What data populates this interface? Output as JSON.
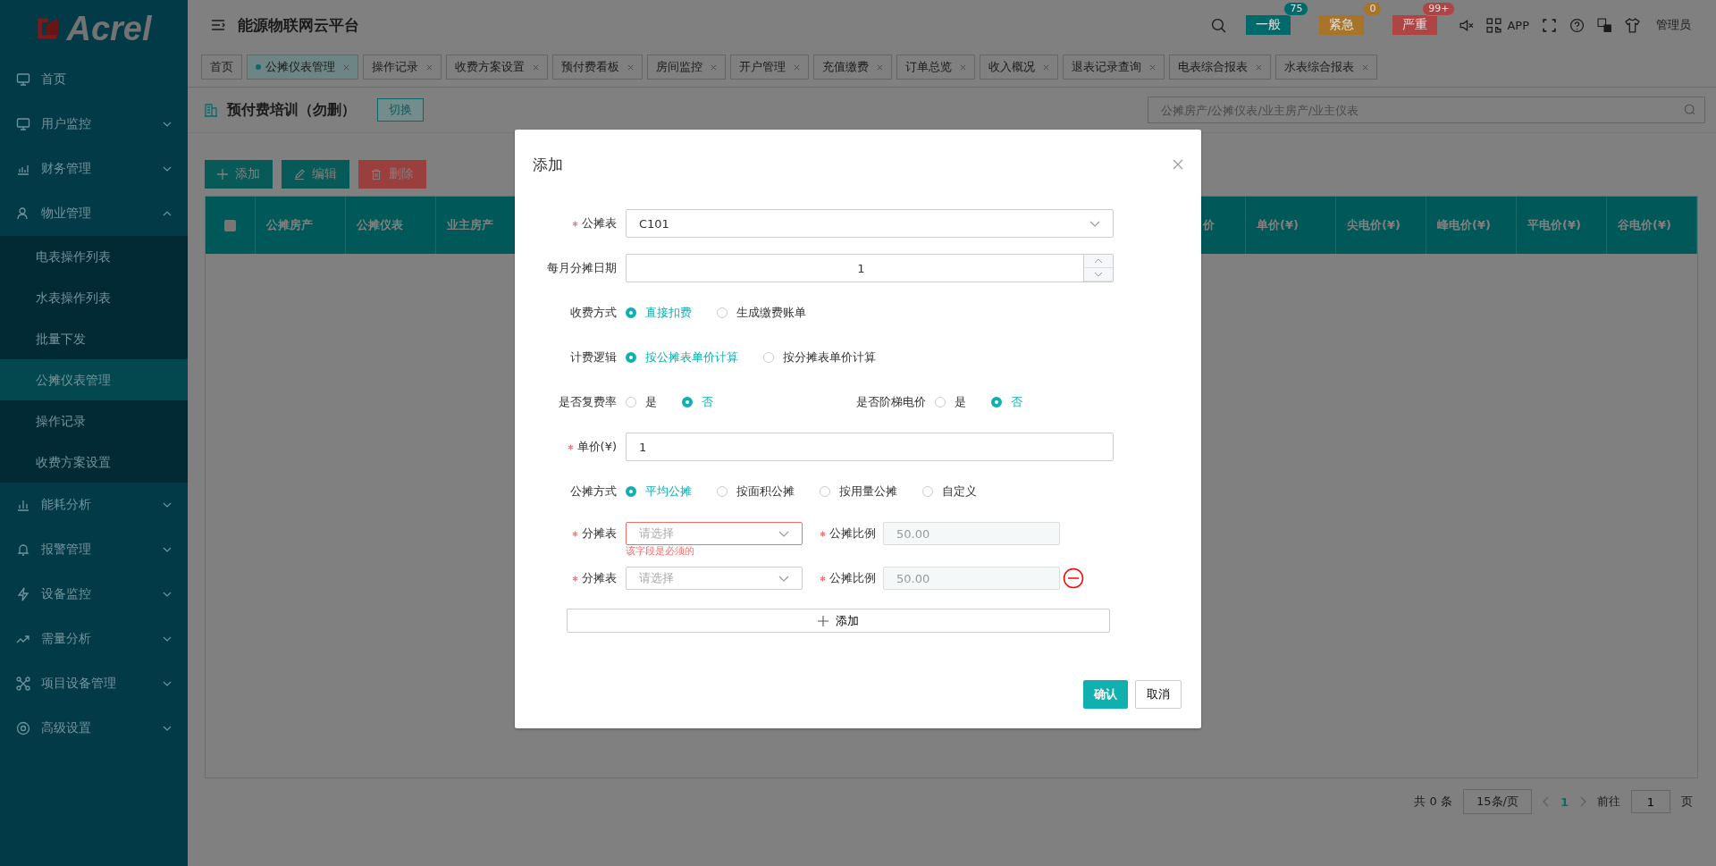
{
  "logo": "Acrel",
  "header": {
    "title": "能源物联网云平台",
    "app_label": "APP",
    "user": "管理员",
    "alarms": [
      {
        "label": "一般",
        "count": "75",
        "color": "#006a6a"
      },
      {
        "label": "紧急",
        "count": "0",
        "color": "#a8742a"
      },
      {
        "label": "严重",
        "count": "99+",
        "color": "#ae4444"
      }
    ]
  },
  "tabs": [
    {
      "label": "首页",
      "selected": false,
      "closable": false
    },
    {
      "label": "公摊仪表管理",
      "selected": true,
      "closable": true
    },
    {
      "label": "操作记录",
      "selected": false,
      "closable": true
    },
    {
      "label": "收费方案设置",
      "selected": false,
      "closable": true
    },
    {
      "label": "预付费看板",
      "selected": false,
      "closable": true
    },
    {
      "label": "房间监控",
      "selected": false,
      "closable": true
    },
    {
      "label": "开户管理",
      "selected": false,
      "closable": true
    },
    {
      "label": "充值缴费",
      "selected": false,
      "closable": true
    },
    {
      "label": "订单总览",
      "selected": false,
      "closable": true
    },
    {
      "label": "收入概况",
      "selected": false,
      "closable": true
    },
    {
      "label": "退表记录查询",
      "selected": false,
      "closable": true
    },
    {
      "label": "电表综合报表",
      "selected": false,
      "closable": true
    },
    {
      "label": "水表综合报表",
      "selected": false,
      "closable": true
    }
  ],
  "sidebar": {
    "items": [
      {
        "label": "首页",
        "selected": false
      },
      {
        "label": "用户监控",
        "selected": false,
        "expanded": false
      },
      {
        "label": "财务管理",
        "selected": false,
        "expanded": false
      },
      {
        "label": "物业管理",
        "selected": false,
        "expanded": true,
        "children": [
          {
            "label": "电表操作列表",
            "selected": false
          },
          {
            "label": "水表操作列表",
            "selected": false
          },
          {
            "label": "批量下发",
            "selected": false
          },
          {
            "label": "公摊仪表管理",
            "selected": true
          },
          {
            "label": "操作记录",
            "selected": false
          },
          {
            "label": "收费方案设置",
            "selected": false
          }
        ]
      },
      {
        "label": "能耗分析",
        "selected": false,
        "expanded": false
      },
      {
        "label": "报警管理",
        "selected": false,
        "expanded": false
      },
      {
        "label": "设备监控",
        "selected": false,
        "expanded": false
      },
      {
        "label": "需量分析",
        "selected": false,
        "expanded": false
      },
      {
        "label": "项目设备管理",
        "selected": false,
        "expanded": false
      },
      {
        "label": "高级设置",
        "selected": false,
        "expanded": false
      }
    ]
  },
  "page": {
    "title": "预付费培训（勿删）",
    "switch_button": "切换",
    "search": {
      "placeholder": "公摊房产/公摊仪表/业主房产/业主仪表"
    },
    "toolbar": [
      {
        "label": "添加",
        "kind": "add"
      },
      {
        "label": "编辑",
        "kind": "edit"
      },
      {
        "label": "删除",
        "kind": "delete"
      }
    ],
    "table": {
      "select_all_checked": false,
      "columns_left": [
        "公摊房产",
        "公摊仪表",
        "业主房产"
      ],
      "column_partial": "价",
      "columns_right": [
        "单价(¥)",
        "尖电价(¥)",
        "峰电价(¥)",
        "平电价(¥)",
        "谷电价(¥)"
      ]
    },
    "pagination": {
      "total": "共 0 条",
      "page_size": "15条/页",
      "current_page": "1",
      "goto_label": "前往",
      "goto_value": "1",
      "page_suffix": "页"
    }
  },
  "dialog": {
    "title": "添加",
    "rows": [
      {
        "kind": "select",
        "label": "公摊表",
        "required": true,
        "value": "C101"
      },
      {
        "kind": "number",
        "label": "每月分摊日期",
        "required": false,
        "value": "1"
      },
      {
        "kind": "radio",
        "groups": [
          {
            "label": "收费方式",
            "options": [
              {
                "label": "直接扣费",
                "selected": true
              },
              {
                "label": "生成缴费账单",
                "selected": false
              }
            ]
          }
        ]
      },
      {
        "kind": "radio",
        "groups": [
          {
            "label": "计费逻辑",
            "options": [
              {
                "label": "按公摊表单价计算",
                "selected": true
              },
              {
                "label": "按分摊表单价计算",
                "selected": false
              }
            ]
          }
        ]
      },
      {
        "kind": "radio",
        "groups": [
          {
            "label": "是否复费率",
            "options": [
              {
                "label": "是",
                "selected": false
              },
              {
                "label": "否",
                "selected": true
              }
            ]
          },
          {
            "label": "是否阶梯电价",
            "options": [
              {
                "label": "是",
                "selected": false
              },
              {
                "label": "否",
                "selected": true
              }
            ]
          }
        ]
      },
      {
        "kind": "text",
        "label": "单价(¥)",
        "required": true,
        "value": "1"
      },
      {
        "kind": "radio",
        "groups": [
          {
            "label": "公摊方式",
            "options": [
              {
                "label": "平均公摊",
                "selected": true
              },
              {
                "label": "按面积公摊",
                "selected": false
              },
              {
                "label": "按用量公摊",
                "selected": false
              },
              {
                "label": "自定义",
                "selected": false
              }
            ]
          }
        ]
      }
    ],
    "allocations": [
      {
        "meter_label": "分摊表",
        "placeholder": "请选择",
        "error": "该字段是必须的",
        "ratio_label": "公摊比例",
        "ratio": "50.00",
        "removable": false
      },
      {
        "meter_label": "分摊表",
        "placeholder": "请选择",
        "ratio_label": "公摊比例",
        "ratio": "50.00",
        "removable": true
      }
    ],
    "add_row_button": "添加",
    "confirm": "确认",
    "cancel": "取消"
  }
}
